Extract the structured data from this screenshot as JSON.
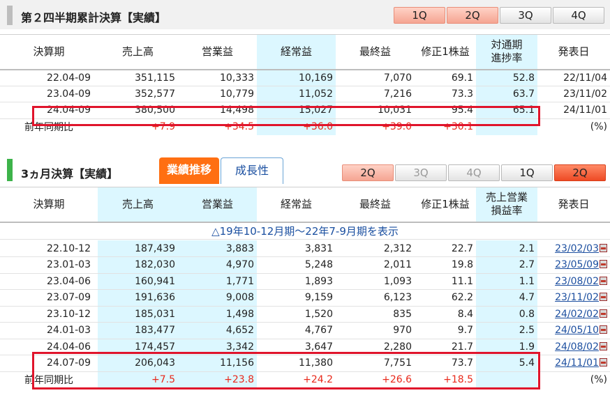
{
  "section1": {
    "title": "第２四半期累計決算【実績】",
    "quarter_tabs": [
      "1Q",
      "2Q",
      "3Q",
      "4Q"
    ],
    "headers": [
      "決算期",
      "売上高",
      "営業益",
      "経常益",
      "最終益",
      "修正1株益",
      "対通期\n進捗率",
      "発表日"
    ],
    "rows": [
      [
        "22.04-09",
        "351,115",
        "10,333",
        "10,169",
        "7,070",
        "69.1",
        "52.8",
        "22/11/04"
      ],
      [
        "23.04-09",
        "352,577",
        "10,779",
        "11,052",
        "7,216",
        "73.3",
        "63.7",
        "23/11/02"
      ],
      [
        "24.04-09",
        "380,500",
        "14,498",
        "15,027",
        "10,031",
        "95.4",
        "65.1",
        "24/11/01"
      ]
    ],
    "yoy": [
      "前年同期比",
      "+7.9",
      "+34.5",
      "+36.0",
      "+39.0",
      "+30.1",
      "",
      "(%)"
    ]
  },
  "section2": {
    "title": "3ヵ月決算【実績】",
    "tab_performance": "業績推移",
    "tab_growth": "成長性",
    "quarter_tabs": [
      "2Q",
      "3Q",
      "4Q",
      "1Q",
      "2Q"
    ],
    "headers": [
      "決算期",
      "売上高",
      "営業益",
      "経常益",
      "最終益",
      "修正1株益",
      "売上営業\n損益率",
      "発表日"
    ],
    "toggle_link": "△19年10-12月期～22年7-9月期を表示",
    "rows": [
      [
        "22.10-12",
        "187,439",
        "3,883",
        "3,831",
        "2,312",
        "22.7",
        "2.1",
        "23/02/03"
      ],
      [
        "23.01-03",
        "182,030",
        "4,970",
        "5,248",
        "2,011",
        "19.8",
        "2.7",
        "23/05/09"
      ],
      [
        "23.04-06",
        "160,941",
        "1,771",
        "1,893",
        "1,093",
        "11.1",
        "1.1",
        "23/08/02"
      ],
      [
        "23.07-09",
        "191,636",
        "9,008",
        "9,159",
        "6,123",
        "62.2",
        "4.7",
        "23/11/02"
      ],
      [
        "23.10-12",
        "185,031",
        "1,498",
        "1,520",
        "835",
        "8.4",
        "0.8",
        "24/02/02"
      ],
      [
        "24.01-03",
        "183,477",
        "4,652",
        "4,767",
        "970",
        "9.7",
        "2.5",
        "24/05/10"
      ],
      [
        "24.04-06",
        "174,457",
        "3,342",
        "3,647",
        "2,280",
        "21.7",
        "1.9",
        "24/08/02"
      ],
      [
        "24.07-09",
        "206,043",
        "11,156",
        "11,380",
        "7,751",
        "73.7",
        "5.4",
        "24/11/01"
      ]
    ],
    "yoy": [
      "前年同期比",
      "+7.5",
      "+23.8",
      "+24.2",
      "+26.6",
      "+18.5",
      "",
      "(%)"
    ]
  },
  "colors": {
    "accent_orange": "#ff6f12",
    "positive_red": "#e8281a",
    "highlight_blue": "#dcf7ff",
    "link_blue": "#1a4fa0",
    "box_red": "#e0142b"
  },
  "icons": {
    "report": "pdf-icon"
  }
}
